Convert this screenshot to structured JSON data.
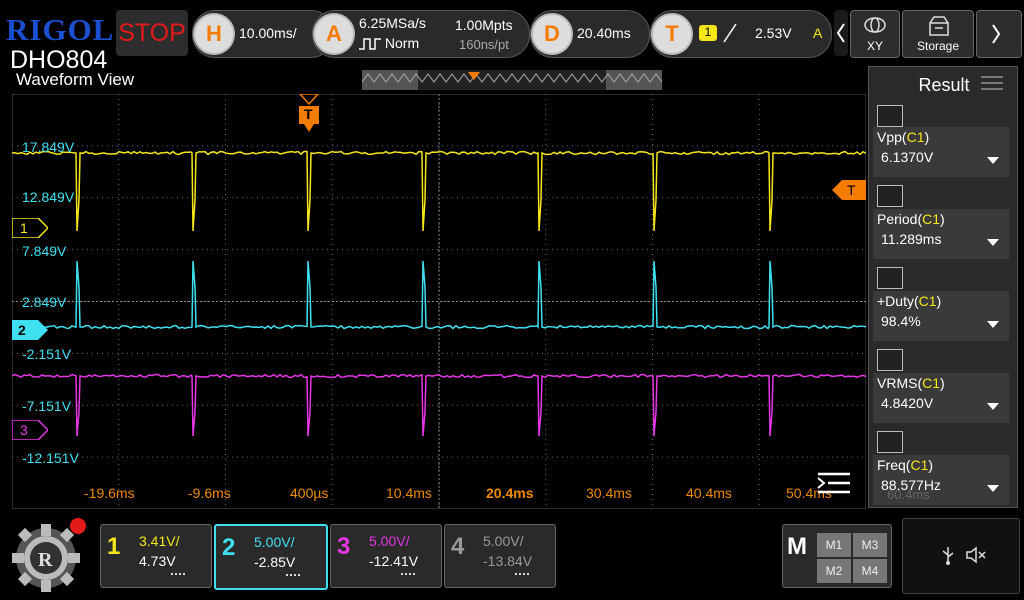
{
  "brand": "RIGOL",
  "model": "DHO804",
  "run_state": "STOP",
  "horizontal": {
    "key": "H",
    "timebase": "10.00ms/"
  },
  "acquire": {
    "key": "A",
    "sample_rate": "6.25MSa/s",
    "mode": "Norm",
    "points": "1.00Mpts",
    "interval": "160ns/pt"
  },
  "delay": {
    "key": "D",
    "value": "20.40ms"
  },
  "trigger": {
    "key": "T",
    "source": "1",
    "level": "2.53V",
    "status": "A"
  },
  "right_buttons": {
    "xy": "XY",
    "storage": "Storage"
  },
  "waveform_view": {
    "title": "Waveform View",
    "trigger_marker": "T",
    "trigger_level_marker": "T"
  },
  "y_labels": [
    "17.849V",
    "12.849V",
    "7.849V",
    "2.849V",
    "-2.151V",
    "-7.151V",
    "-12.151V"
  ],
  "x_labels": [
    "-19.6ms",
    "-9.6ms",
    "400µs",
    "10.4ms",
    "20.4ms",
    "30.4ms",
    "40.4ms",
    "50.4ms"
  ],
  "channel_markers": [
    "1",
    "2",
    "3"
  ],
  "result_panel": {
    "title": "Result",
    "items": [
      {
        "name": "Vpp",
        "src": "C1",
        "value": "6.1370V"
      },
      {
        "name": "Period",
        "src": "C1",
        "value": "11.289ms"
      },
      {
        "name": "+Duty",
        "src": "C1",
        "value": "98.4%"
      },
      {
        "name": "VRMS",
        "src": "C1",
        "value": "4.8420V"
      },
      {
        "name": "Freq",
        "src": "C1",
        "value": "88.577Hz"
      }
    ],
    "ghost_value": "60.4ms"
  },
  "channels": [
    {
      "num": "1",
      "scale": "3.41V/",
      "offset": "4.73V",
      "color": "#f5e61a"
    },
    {
      "num": "2",
      "scale": "5.00V/",
      "offset": "-2.85V",
      "color": "#3ee0f0"
    },
    {
      "num": "3",
      "scale": "5.00V/",
      "offset": "-12.41V",
      "color": "#e636e6"
    },
    {
      "num": "4",
      "scale": "5.00V/",
      "offset": "-13.84V",
      "color": "#9a9a9a"
    }
  ],
  "math": {
    "label": "M",
    "items": [
      "M1",
      "M3",
      "M2",
      "M4"
    ]
  },
  "colors": {
    "ch1": "#f5e61a",
    "ch2": "#3ee0f0",
    "ch3": "#e636e6",
    "ch4": "#9a9a9a",
    "accent": "#f47c00",
    "brand": "#1a4fd0",
    "stop": "#e41a1a"
  }
}
